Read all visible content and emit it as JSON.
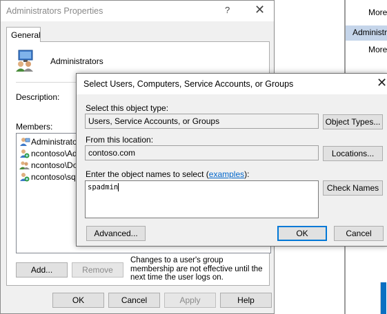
{
  "background_window": {
    "more_1": "More",
    "header": "Administrators",
    "more_2": "More"
  },
  "properties_dialog": {
    "title": "Administrators Properties",
    "help": "?",
    "close": "✕",
    "tab_general": "General",
    "group_name": "Administrators",
    "description_label": "Description:",
    "members_label": "Members:",
    "members": [
      "Administrator",
      "ncontoso\\Adr",
      "ncontoso\\Dor",
      "ncontoso\\sqla"
    ],
    "add_label": "Add...",
    "remove_label": "Remove",
    "note": "Changes to a user's group membership are not effective until the next time the user logs on.",
    "ok_label": "OK",
    "cancel_label": "Cancel",
    "apply_label": "Apply",
    "help_label": "Help"
  },
  "select_dialog": {
    "title": "Select Users, Computers, Service Accounts, or Groups",
    "close": "✕",
    "object_type_label": "Select this object type:",
    "object_type_value": "Users, Service Accounts, or Groups",
    "object_types_button": "Object Types...",
    "location_label": "From this location:",
    "location_value": "contoso.com",
    "locations_button": "Locations...",
    "names_label_prefix": "Enter the object names to select (",
    "names_label_link": "examples",
    "names_label_suffix": "):",
    "names_value": "spadmin",
    "check_names_button": "Check Names",
    "advanced_button": "Advanced...",
    "ok_button": "OK",
    "cancel_button": "Cancel"
  }
}
